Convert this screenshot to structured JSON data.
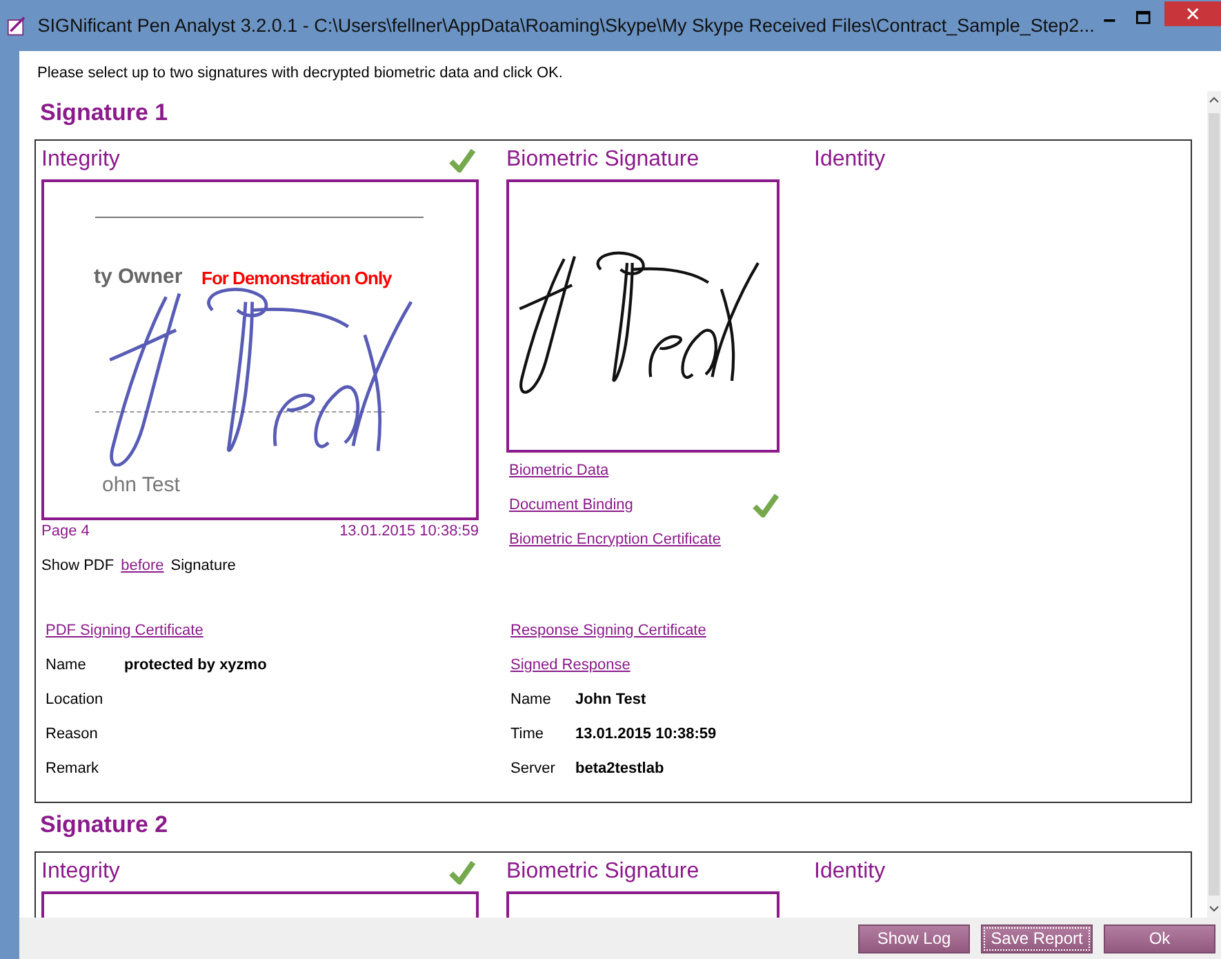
{
  "window": {
    "title": "SIGNificant Pen Analyst 3.2.0.1 - C:\\Users\\fellner\\AppData\\Roaming\\Skype\\My Skype Received Files\\Contract_Sample_Step2...",
    "instruction": "Please select up to two signatures with decrypted biometric data and click OK."
  },
  "signatures": [
    {
      "title": "Signature 1",
      "integrity": {
        "heading": "Integrity",
        "verified": true,
        "document_lines": [
          "ty Owner",
          "ohn Test"
        ],
        "watermark": "For Demonstration Only",
        "page": "Page 4",
        "timestamp": "13.01.2015 10:38:59",
        "show_pdf": {
          "prefix": "Show PDF",
          "link": "before",
          "suffix": "Signature"
        }
      },
      "biometric": {
        "heading": "Biometric Signature",
        "links": [
          {
            "label": "Biometric Data",
            "verified": false
          },
          {
            "label": "Document Binding",
            "verified": true
          },
          {
            "label": "Biometric Encryption Certificate",
            "verified": false
          }
        ]
      },
      "identity": {
        "heading": "Identity"
      },
      "certificate": {
        "link": "PDF Signing Certificate",
        "fields": [
          {
            "label": "Name",
            "value": "protected by xyzmo"
          },
          {
            "label": "Location"
          },
          {
            "label": "Reason"
          },
          {
            "label": "Remark"
          }
        ]
      },
      "response": {
        "links": [
          "Response Signing Certificate",
          "Signed Response"
        ],
        "fields": [
          {
            "label": "Name",
            "value": "John Test"
          },
          {
            "label": "Time",
            "value": "13.01.2015 10:38:59"
          },
          {
            "label": "Server",
            "value": "beta2testlab"
          }
        ]
      }
    },
    {
      "title": "Signature 2",
      "integrity": {
        "heading": "Integrity",
        "verified": true
      },
      "biometric": {
        "heading": "Biometric Signature"
      },
      "identity": {
        "heading": "Identity"
      }
    }
  ],
  "buttons": [
    {
      "label": "Show Log",
      "focused": false
    },
    {
      "label": "Save Report",
      "focused": true
    },
    {
      "label": "Ok",
      "focused": false
    }
  ]
}
